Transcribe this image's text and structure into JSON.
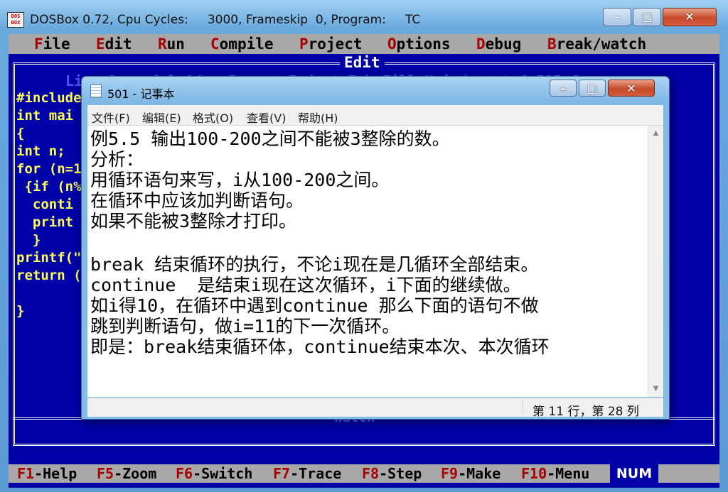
{
  "dosbox": {
    "app_icon": "DOS\nBOX",
    "title": "DOSBox 0.72, Cpu Cycles:     3000, Frameskip  0, Program:     TC",
    "controls": {
      "minimize": "–",
      "maximize": "□",
      "close": "✕"
    }
  },
  "tc": {
    "menus": [
      {
        "hotkey": "F",
        "rest": "ile"
      },
      {
        "hotkey": "E",
        "rest": "dit"
      },
      {
        "hotkey": "R",
        "rest": "un"
      },
      {
        "hotkey": "C",
        "rest": "ompile"
      },
      {
        "hotkey": "P",
        "rest": "roject"
      },
      {
        "hotkey": "O",
        "rest": "ptions"
      },
      {
        "hotkey": "D",
        "rest": "ebug"
      },
      {
        "hotkey": "B",
        "rest": "reak/watch"
      }
    ],
    "edit_title": "Edit",
    "status_line": "Line 9    Col 14   Insert Indent Tab Fill Unindent * C:505.C",
    "code_lines": [
      "#include",
      "int mai",
      "{",
      "int n;",
      "for (n=1",
      " {if (n%",
      "  conti",
      "  print",
      "  }",
      "printf(\"",
      "return (",
      "",
      "}"
    ],
    "watch_label": "Watch",
    "fkeys": [
      {
        "key": "F1",
        "label": "-Help"
      },
      {
        "key": "F5",
        "label": "-Zoom"
      },
      {
        "key": "F6",
        "label": "-Switch"
      },
      {
        "key": "F7",
        "label": "-Trace"
      },
      {
        "key": "F8",
        "label": "-Step"
      },
      {
        "key": "F9",
        "label": "-Make"
      },
      {
        "key": "F10",
        "label": "-Menu"
      }
    ],
    "num_indicator": "NUM"
  },
  "notepad": {
    "title": "501 - 记事本",
    "controls": {
      "minimize": "–",
      "maximize": "□",
      "close": "✕"
    },
    "menus": [
      "文件(F)",
      "编辑(E)",
      "格式(O)",
      "查看(V)",
      "帮助(H)"
    ],
    "lines": [
      "例5.5 输出100-200之间不能被3整除的数。",
      "分析：",
      "用循环语句来写，i从100-200之间。",
      "在循环中应该加判断语句。",
      "如果不能被3整除才打印。",
      "",
      "break 结束循环的执行，不论i现在是几循环全部结束。",
      "continue  是结束i现在这次循环，i下面的继续做。",
      "如i得10，在循环中遇到continue 那么下面的语句不做",
      "跳到判断语句，做i=11的下一次循环。",
      "即是：break结束循环体，continue结束本次、本次循环"
    ],
    "scroll_up": "▲",
    "scroll_down": "▼",
    "status_position": "第 11 行，第 28 列"
  }
}
